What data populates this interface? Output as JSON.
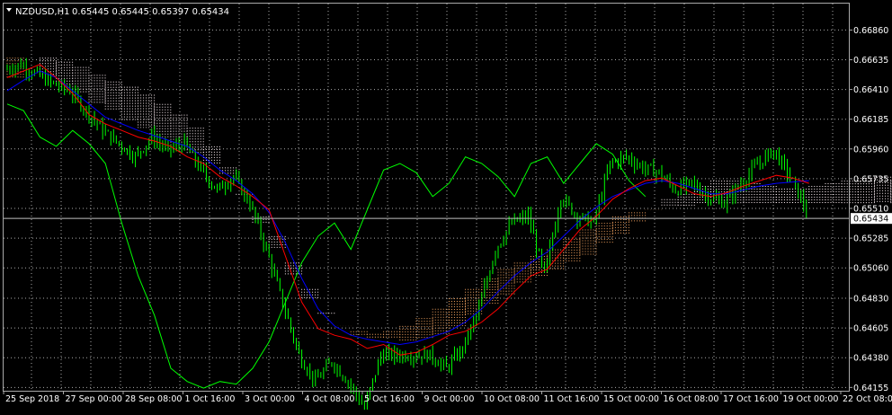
{
  "header": {
    "symbol": "NZDUSD,H1",
    "ohlc": "0.65445 0.65445 0.65397 0.65434"
  },
  "current_price_label": "0.65434",
  "colors": {
    "background": "#000000",
    "grid": "#a9a9a9",
    "candles": "#00ff00",
    "tenkan_sen": "#ff0000",
    "kijun_sen": "#0000ff",
    "chikou_span": "#00ff00",
    "kumo_bearish": "#fff0f5",
    "kumo_bullish": "#f4a460",
    "price_line": "#c0c0c0"
  },
  "chart_data": {
    "type": "line",
    "indicator": "Ichimoku Kinko Hyo",
    "timeframe": "H1",
    "x_tick_labels": [
      "25 Sep 2018",
      "27 Sep 00:00",
      "28 Sep 08:00",
      "1 Oct 16:00",
      "3 Oct 00:00",
      "4 Oct 08:00",
      "5 Oct 16:00",
      "9 Oct 00:00",
      "10 Oct 08:00",
      "11 Oct 16:00",
      "15 Oct 00:00",
      "16 Oct 08:00",
      "17 Oct 16:00",
      "19 Oct 00:00",
      "22 Oct 08:00"
    ],
    "y_tick_labels": [
      "0.66860",
      "0.66635",
      "0.66410",
      "0.66185",
      "0.65960",
      "0.65735",
      "0.65510",
      "0.65285",
      "0.65060",
      "0.64830",
      "0.64605",
      "0.64380",
      "0.64155"
    ],
    "ylim": [
      0.6413,
      0.6706
    ],
    "current_price": 0.65434,
    "grid": true,
    "series": [
      {
        "values": [
          0.6656,
          0.666,
          0.6652,
          0.6645,
          0.664,
          0.6625,
          0.661,
          0.66,
          0.659,
          0.6605,
          0.6595,
          0.66,
          0.658,
          0.6565,
          0.6575,
          0.6555,
          0.652,
          0.648,
          0.644,
          0.642,
          0.6435,
          0.642,
          0.64,
          0.644,
          0.644,
          0.644,
          0.644,
          0.643,
          0.6445,
          0.6475,
          0.652,
          0.654,
          0.6545,
          0.65,
          0.656,
          0.6545,
          0.654,
          0.6585,
          0.659,
          0.6582,
          0.6578,
          0.6565,
          0.657,
          0.656,
          0.6555,
          0.657,
          0.6584,
          0.6595,
          0.6575,
          0.655
        ]
      },
      {
        "values": [
          0.665,
          0.6655,
          0.666,
          0.665,
          0.6638,
          0.6622,
          0.6615,
          0.661,
          0.6605,
          0.6602,
          0.6598,
          0.659,
          0.6585,
          0.6575,
          0.6568,
          0.656,
          0.655,
          0.6515,
          0.648,
          0.646,
          0.6455,
          0.6452,
          0.6445,
          0.6448,
          0.644,
          0.6442,
          0.6448,
          0.6455,
          0.6458,
          0.6465,
          0.6475,
          0.6488,
          0.65,
          0.6505,
          0.652,
          0.6535,
          0.6545,
          0.6558,
          0.6566,
          0.6572,
          0.6574,
          0.6568,
          0.6562,
          0.656,
          0.6563,
          0.6568,
          0.6572,
          0.6576,
          0.6574,
          0.657
        ]
      },
      {
        "values": [
          0.664,
          0.6648,
          0.6655,
          0.665,
          0.664,
          0.663,
          0.662,
          0.6615,
          0.661,
          0.6606,
          0.6602,
          0.6598,
          0.659,
          0.658,
          0.6572,
          0.6562,
          0.6548,
          0.6525,
          0.6498,
          0.6475,
          0.6462,
          0.6455,
          0.6452,
          0.645,
          0.6448,
          0.645,
          0.6454,
          0.6458,
          0.6465,
          0.6475,
          0.6488,
          0.65,
          0.651,
          0.6518,
          0.653,
          0.6542,
          0.6552,
          0.656,
          0.6565,
          0.657,
          0.6572,
          0.657,
          0.6566,
          0.6562,
          0.6562,
          0.6565,
          0.6568,
          0.657,
          0.6571,
          0.6572
        ]
      },
      {
        "values": [
          0.663,
          0.6625,
          0.6605,
          0.6598,
          0.661,
          0.66,
          0.6585,
          0.654,
          0.65,
          0.647,
          0.643,
          0.642,
          0.6415,
          0.642,
          0.6418,
          0.643,
          0.645,
          0.648,
          0.651,
          0.653,
          0.654,
          0.652,
          0.655,
          0.658,
          0.6585,
          0.6578,
          0.656,
          0.657,
          0.659,
          0.6585,
          0.6575,
          0.656,
          0.6585,
          0.659,
          0.657,
          0.6585,
          0.66,
          0.6592,
          0.6572,
          0.656
        ]
      },
      {
        "values": [
          0.6665,
          0.666,
          0.6652,
          0.6645,
          0.6638,
          0.663,
          0.6625,
          0.6618,
          0.6612,
          0.6605,
          0.6598,
          0.6592,
          0.6585,
          0.6576,
          0.656,
          0.654,
          0.652,
          0.65,
          0.6482,
          0.647,
          0.6462,
          0.6458,
          0.6456,
          0.6458,
          0.6462,
          0.6468,
          0.6475,
          0.6483,
          0.649,
          0.6498,
          0.6505,
          0.651,
          0.6515,
          0.652,
          0.6528,
          0.6535,
          0.654,
          0.6545,
          0.6548,
          0.655,
          0.6552,
          0.6553,
          0.6555,
          0.6555,
          0.6555,
          0.6555,
          0.6555,
          0.6555,
          0.6555,
          0.6555,
          0.6555,
          0.6555,
          0.6555,
          0.6555,
          0.6555,
          0.6555,
          0.6555,
          0.6555,
          0.6555,
          0.6555
        ]
      },
      {
        "values": [
          0.665,
          0.666,
          0.6665,
          0.6662,
          0.6658,
          0.6652,
          0.6647,
          0.6643,
          0.6637,
          0.663,
          0.6622,
          0.6612,
          0.6598,
          0.6582,
          0.6562,
          0.6545,
          0.653,
          0.651,
          0.649,
          0.6472,
          0.6462,
          0.6455,
          0.6452,
          0.6452,
          0.645,
          0.6452,
          0.6455,
          0.6462,
          0.647,
          0.6478,
          0.6486,
          0.6494,
          0.65,
          0.6505,
          0.651,
          0.6515,
          0.6524,
          0.6532,
          0.654,
          0.655,
          0.6558,
          0.6562,
          0.6568,
          0.6572,
          0.6572,
          0.657,
          0.6568,
          0.6566,
          0.6566,
          0.6568,
          0.657,
          0.6572,
          0.6574,
          0.6575,
          0.6572,
          0.657,
          0.6568,
          0.6567,
          0.6567,
          0.6568
        ]
      }
    ]
  }
}
